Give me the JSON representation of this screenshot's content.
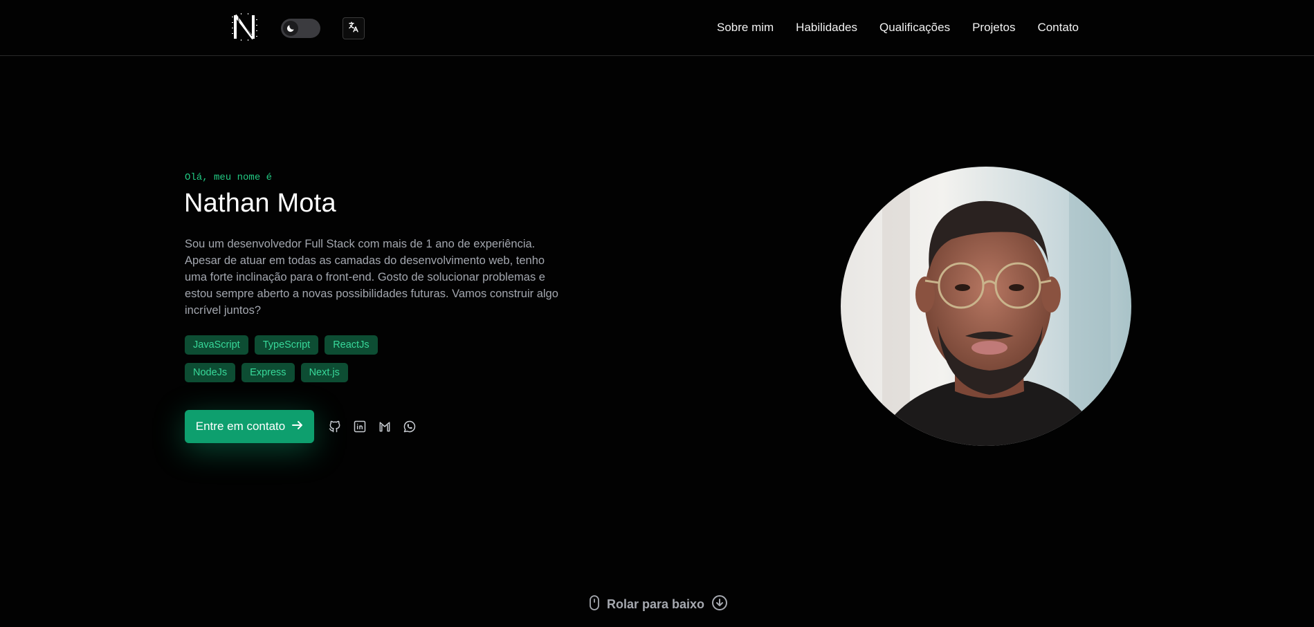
{
  "header": {
    "logo_icon": "n-logo-icon",
    "theme_toggle_icon": "moon-icon",
    "language_icon": "translate-icon",
    "nav": [
      {
        "label": "Sobre mim"
      },
      {
        "label": "Habilidades"
      },
      {
        "label": "Qualificações"
      },
      {
        "label": "Projetos"
      },
      {
        "label": "Contato"
      }
    ]
  },
  "hero": {
    "greeting": "Olá, meu nome é",
    "name": "Nathan Mota",
    "bio": "Sou um desenvolvedor Full Stack com mais de 1 ano de experiência. Apesar de atuar em todas as camadas do desenvolvimento web, tenho uma forte inclinação para o front-end. Gosto de solucionar problemas e estou sempre aberto a novas possibilidades futuras. Vamos construir algo incrível juntos?",
    "tags": [
      "JavaScript",
      "TypeScript",
      "ReactJs",
      "NodeJs",
      "Express",
      "Next.js"
    ],
    "cta_label": "Entre em contato",
    "socials": [
      "github-icon",
      "linkedin-icon",
      "gmail-icon",
      "whatsapp-icon"
    ]
  },
  "scroll": {
    "label": "Rolar para baixo"
  },
  "colors": {
    "accent": "#0e9f6e",
    "accent_text": "#22c983",
    "tag_bg": "#0d4d33",
    "background": "#020202"
  }
}
